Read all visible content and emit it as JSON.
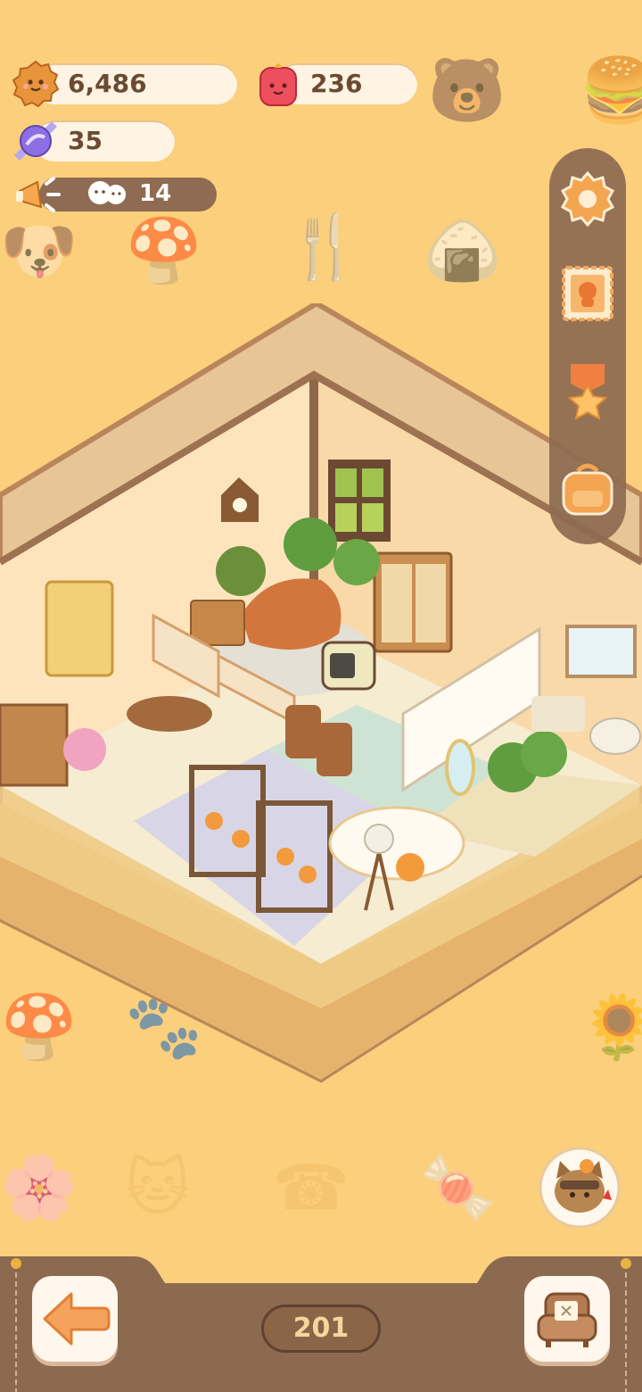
{
  "currencies": {
    "cookies": "6,486",
    "gems": "236",
    "candy": "35",
    "visitors": "14"
  },
  "sidebar": {
    "items": [
      "settings-icon",
      "stamp-card-icon",
      "medal-icon",
      "backpack-icon"
    ]
  },
  "bottom": {
    "level": "201",
    "back_icon": "arrow-left-icon",
    "furniture_icon": "armchair-icon"
  },
  "colors": {
    "background": "#fbcf7c",
    "panel_brown": "#8e6b52",
    "pill": "#fff4e3",
    "accent_orange": "#f3a24e"
  }
}
